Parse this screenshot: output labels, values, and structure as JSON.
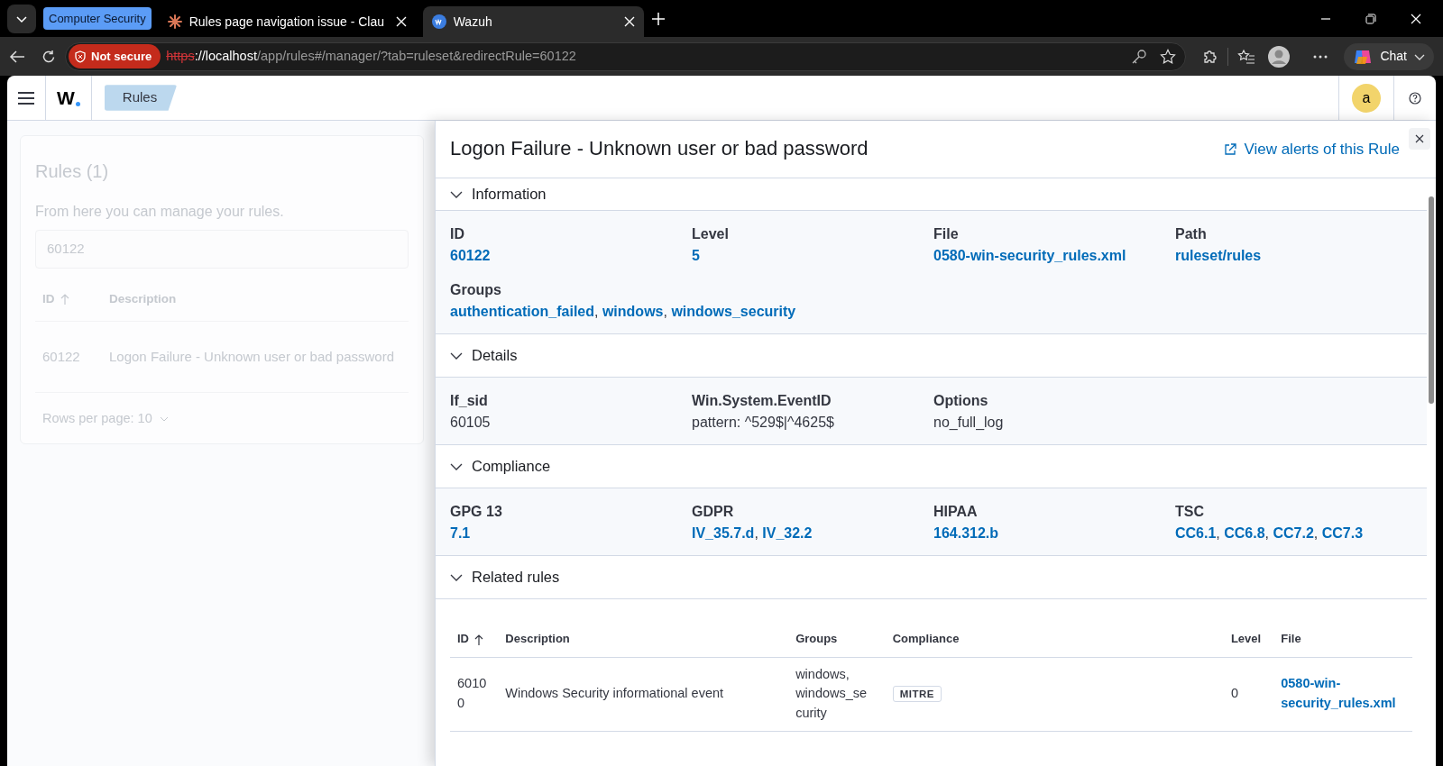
{
  "browser": {
    "tabs": [
      {
        "kind": "group",
        "label": "Computer Security",
        "selected": false
      },
      {
        "kind": "chat",
        "label": "Rules page navigation issue - Clau",
        "selected": false
      },
      {
        "kind": "app",
        "label": "Wazuh",
        "selected": true
      }
    ],
    "security_badge": "Not secure",
    "url_scheme": "https",
    "url_host": "://localhost",
    "url_path": "/app/rules#/manager/?tab=ruleset&redirectRule=60122",
    "chat_label": "Chat"
  },
  "app_header": {
    "logo": "W",
    "breadcrumb": "Rules",
    "avatar": "a"
  },
  "rules_list": {
    "title": "Rules (1)",
    "subtitle": "From here you can manage your rules.",
    "search_value": "60122",
    "columns": [
      {
        "label": "ID",
        "sorted": true
      },
      {
        "label": "Description",
        "sorted": false
      }
    ],
    "rows": [
      [
        "60122",
        "Logon Failure - Unknown user or bad password"
      ]
    ],
    "pagination": "Rows per page: 10"
  },
  "flyout": {
    "title": "Logon Failure - Unknown user or bad password",
    "action": "View alerts of this Rule",
    "sections": [
      {
        "title": "Information",
        "expanded": true,
        "fields": [
          {
            "label": "ID",
            "values": [
              "60122"
            ],
            "link": true
          },
          {
            "label": "Level",
            "values": [
              "5"
            ],
            "link": true
          },
          {
            "label": "File",
            "values": [
              "0580-win-security_rules.xml"
            ],
            "link": true
          },
          {
            "label": "Path",
            "values": [
              "ruleset/rules"
            ],
            "link": true
          },
          {
            "label": "Groups",
            "values": [
              "authentication_failed",
              "windows",
              "windows_security"
            ],
            "separator": ", ",
            "link": true,
            "wide": true
          }
        ]
      },
      {
        "title": "Details",
        "expanded": true,
        "fields": [
          {
            "label": "If_sid",
            "values": [
              "60105"
            ],
            "link": false
          },
          {
            "label": "Win.System.EventID",
            "values": [
              "pattern: ^529$|^4625$"
            ],
            "link": false
          },
          {
            "label": "Options",
            "values": [
              "no_full_log"
            ],
            "link": false
          }
        ]
      },
      {
        "title": "Compliance",
        "expanded": true,
        "fields": [
          {
            "label": "GPG 13",
            "values": [
              "7.1"
            ],
            "link": true
          },
          {
            "label": "GDPR",
            "values": [
              "IV_35.7.d",
              "IV_32.2"
            ],
            "separator": ", ",
            "link": true
          },
          {
            "label": "HIPAA",
            "values": [
              "164.312.b"
            ],
            "link": true
          },
          {
            "label": "TSC",
            "values": [
              "CC6.1",
              "CC6.8",
              "CC7.2",
              "CC7.3"
            ],
            "separator": ", ",
            "link": true
          }
        ]
      },
      {
        "title": "Related rules",
        "expanded": true,
        "table": {
          "columns": [
            {
              "label": "ID",
              "sorted": true
            },
            {
              "label": "Description",
              "sorted": false
            },
            {
              "label": "Groups",
              "sorted": false
            },
            {
              "label": "Compliance",
              "sorted": false
            },
            {
              "label": "Level",
              "sorted": false
            },
            {
              "label": "File",
              "sorted": false
            }
          ],
          "rows": [
            {
              "id": "60100",
              "description": "Windows Security informational event",
              "groups": "windows, windows_security",
              "tags": [
                "MITRE"
              ],
              "level": "0",
              "file": "0580-win-security_rules.xml"
            }
          ]
        }
      }
    ]
  }
}
